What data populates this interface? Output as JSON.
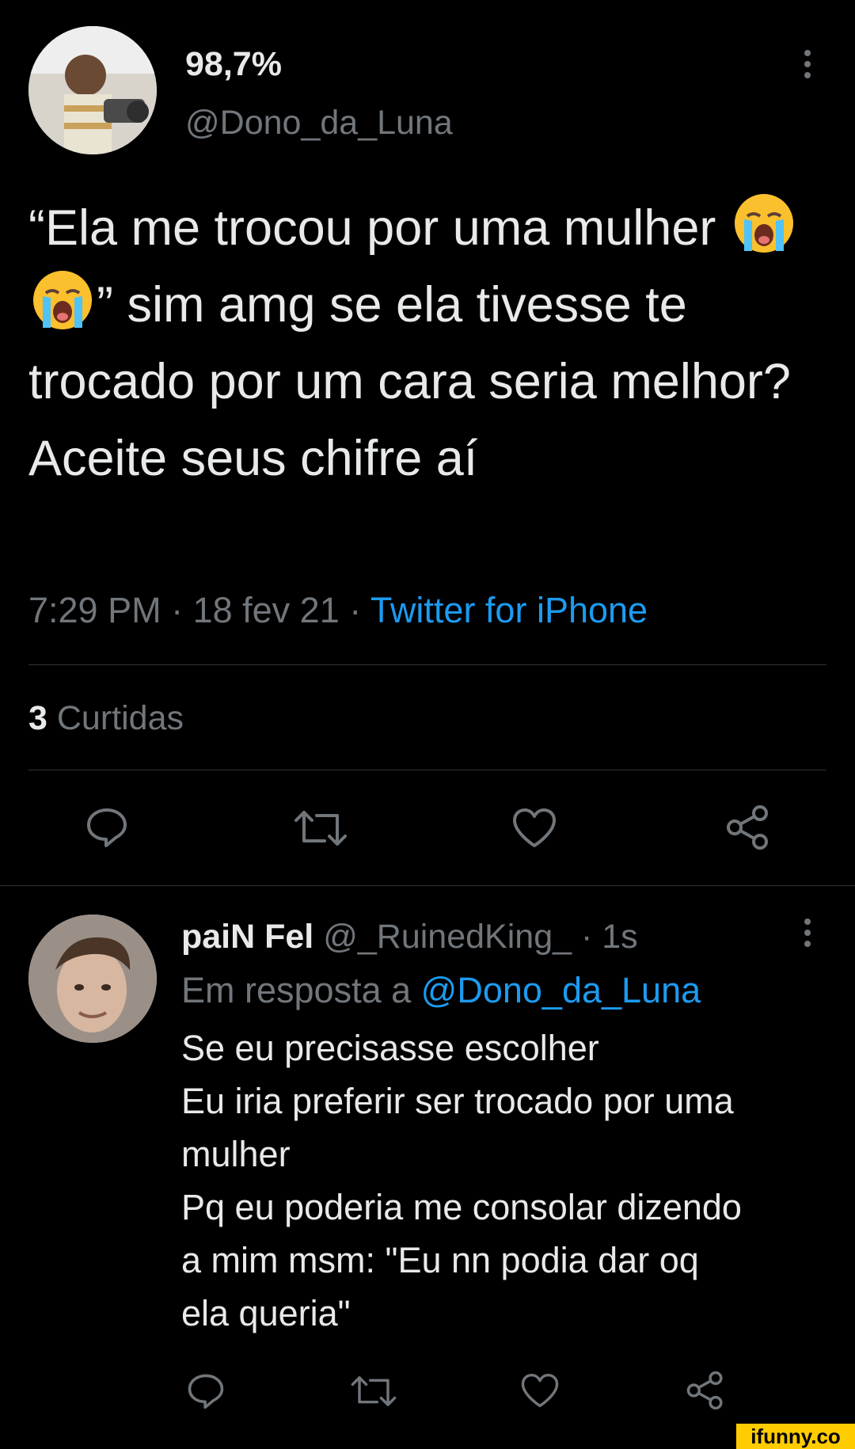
{
  "main_tweet": {
    "display_name": "98,7%",
    "handle": "@Dono_da_Luna",
    "text_part1": "“Ela me trocou por uma mulher ",
    "text_part2": "” sim amg se ela tivesse te trocado por um cara seria melhor? Aceite seus chifre aí",
    "emoji_name": "loudly-crying-face-icon",
    "time": "7:29 PM · 18 fev 21 · ",
    "source": "Twitter for iPhone",
    "likes_count": "3",
    "likes_label": "Curtidas"
  },
  "reply_tweet": {
    "display_name": "paiN Fel",
    "handle_time": "@_RuinedKing_ · 1s",
    "in_reply_to_label": "Em resposta a",
    "in_reply_to_handle": "@Dono_da_Luna",
    "lines": [
      "Se eu precisasse escolher",
      "Eu iria preferir ser trocado por uma",
      "mulher",
      "Pq eu poderia me consolar dizendo",
      "a mim msm: \"Eu nn podia dar oq",
      "ela queria\""
    ]
  },
  "watermark": "ifunny.co",
  "colors": {
    "background": "#000000",
    "text": "#e7e9ea",
    "muted": "#71767b",
    "link": "#1d9bf0",
    "divider": "#2f3336"
  }
}
